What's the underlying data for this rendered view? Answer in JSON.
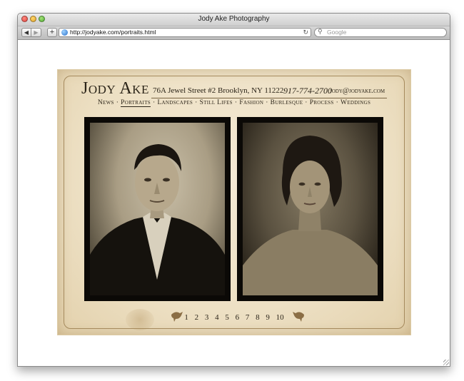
{
  "window": {
    "title": "Jody Ake Photography"
  },
  "toolbar": {
    "back_label": "◀",
    "forward_label": "▶",
    "add_label": "+",
    "url": "http://jodyake.com/portraits.html",
    "reload_label": "↻",
    "search_placeholder": "Google"
  },
  "header": {
    "brand": "Jody Ake",
    "address": "76A Jewel Street #2  Brooklyn, NY 11222",
    "phone": "917-774-2700",
    "email": "jody@jodyake.com"
  },
  "nav": {
    "items": [
      {
        "label": "News"
      },
      {
        "label": "Portraits"
      },
      {
        "label": "Landscapes"
      },
      {
        "label": "Still Lifes"
      },
      {
        "label": "Fashion"
      },
      {
        "label": "Burlesque"
      },
      {
        "label": "Process"
      },
      {
        "label": "Weddings"
      }
    ],
    "separator": "·",
    "active": "Portraits"
  },
  "pager": {
    "pages": [
      "1",
      "2",
      "3",
      "4",
      "5",
      "6",
      "7",
      "8",
      "9",
      "10"
    ]
  },
  "colors": {
    "card_bg": "#ede0c4",
    "ink": "#2b2418",
    "photo_frame": "#0b0906"
  }
}
